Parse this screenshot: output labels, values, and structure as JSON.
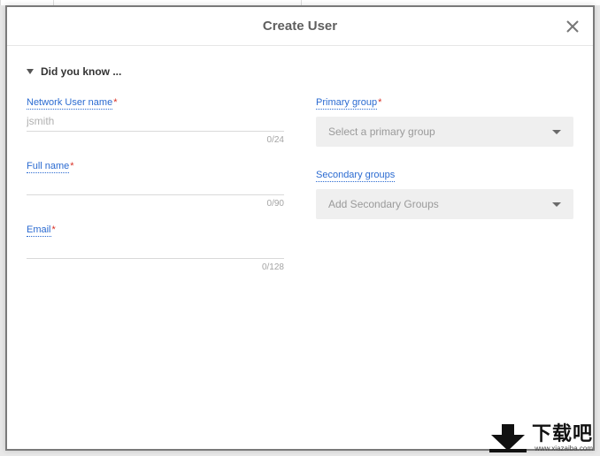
{
  "header": {
    "title": "Create User"
  },
  "disclosure": {
    "label": "Did you know ..."
  },
  "left": {
    "username": {
      "label": "Network User name",
      "placeholder": "jsmith",
      "counter": "0/24"
    },
    "fullname": {
      "label": "Full name",
      "counter": "0/90"
    },
    "email": {
      "label": "Email",
      "counter": "0/128"
    }
  },
  "right": {
    "primary": {
      "label": "Primary group",
      "placeholder": "Select a primary group"
    },
    "secondary": {
      "label": "Secondary groups",
      "placeholder": "Add Secondary Groups"
    }
  },
  "watermark": {
    "brand": "下载吧",
    "url": "www.xiazaiba.com"
  }
}
